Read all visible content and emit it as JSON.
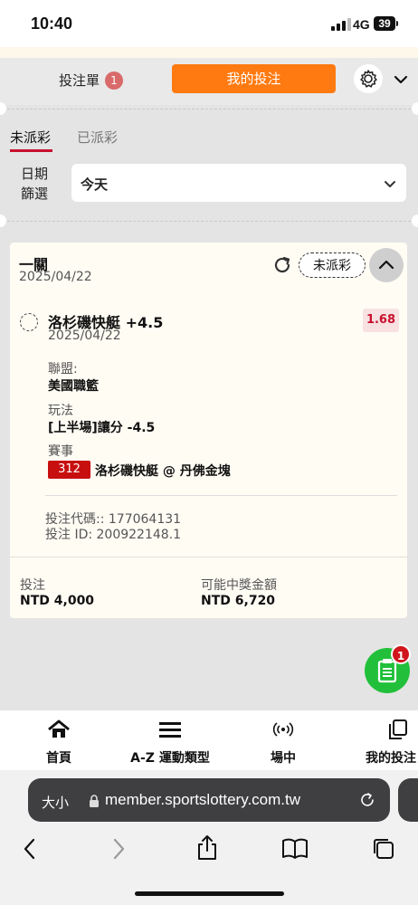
{
  "status_bar": {
    "time": "10:40",
    "network": "4G",
    "battery": "39"
  },
  "header": {
    "bet_slip_label": "投注單",
    "bet_slip_count": "1",
    "my_bets_label": "我的投注"
  },
  "filter": {
    "tabs": [
      {
        "label": "未派彩",
        "active": true
      },
      {
        "label": "已派彩",
        "active": false
      }
    ],
    "date_label": "日期篩選",
    "date_value": "今天"
  },
  "bet": {
    "type": "一關",
    "date": "2025/04/22",
    "status": "未派彩",
    "selection": {
      "name": "洛杉磯快艇 +4.5",
      "date": "2025/04/22",
      "odds": "1.68"
    },
    "league_label": "聯盟:",
    "league_value": "美國職籃",
    "market_label": "玩法",
    "market_value": "[上半場]讓分 -4.5",
    "event_label": "賽事",
    "event_number": "312",
    "event_name": "洛杉磯快艇 @ 丹佛金塊",
    "code_line": "投注代碼:: 177064131",
    "id_line": "投注 ID: 200922148.1",
    "stake_label": "投注",
    "stake_value": "NTD 4,000",
    "payout_label": "可能中獎金額",
    "payout_value": "NTD 6,720"
  },
  "fab": {
    "badge": "1"
  },
  "bottom_nav": {
    "items": [
      {
        "label": "首頁",
        "icon": "home-icon"
      },
      {
        "label": "A-Z 運動類型",
        "icon": "menu-icon"
      },
      {
        "label": "場中",
        "icon": "live-icon"
      },
      {
        "label": "我的投注",
        "icon": "copy-icon"
      }
    ]
  },
  "browser": {
    "text_size": "大小",
    "url": "member.sportslottery.com.tw"
  },
  "colors": {
    "accent": "#ff7a10",
    "red": "#c80f0f",
    "green": "#22c03a",
    "card": "#fffcf4"
  }
}
